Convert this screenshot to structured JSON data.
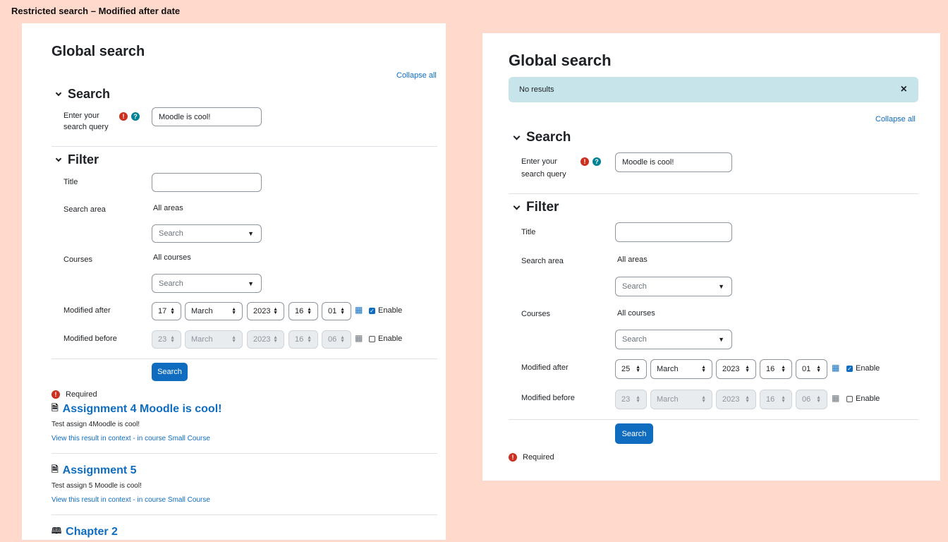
{
  "caption": "Restricted search – Modified after date",
  "left": {
    "title": "Global search",
    "collapse_all": "Collapse all",
    "search_section": "Search",
    "query_label": "Enter your search query",
    "query_value": "Moodle is cool!",
    "filter_section": "Filter",
    "title_label": "Title",
    "search_area_label": "Search area",
    "search_area_value": "All areas",
    "search_area_placeholder": "Search",
    "courses_label": "Courses",
    "courses_value": "All courses",
    "courses_placeholder": "Search",
    "modified_after_label": "Modified after",
    "after": {
      "day": "17",
      "month": "March",
      "year": "2023",
      "hour": "16",
      "minute": "01"
    },
    "modified_before_label": "Modified before",
    "before": {
      "day": "23",
      "month": "March",
      "year": "2023",
      "hour": "16",
      "minute": "06"
    },
    "enable_label": "Enable",
    "search_button": "Search",
    "required": "Required",
    "results": [
      {
        "title": "Assignment 4 Moodle is cool!",
        "text": "Test assign 4Moodle is cool!",
        "link": "View this result in context",
        "course": " - in course Small Course"
      },
      {
        "title": "Assignment 5",
        "text": "Test assign 5 Moodle is cool!",
        "link": "View this result in context",
        "course": " - in course Small Course"
      },
      {
        "title": "Chapter 2"
      }
    ]
  },
  "right": {
    "title": "Global search",
    "alert": "No results",
    "alert_close": "×",
    "collapse_all": "Collapse all",
    "search_section": "Search",
    "query_label": "Enter your search query",
    "query_value": "Moodle is cool!",
    "filter_section": "Filter",
    "title_label": "Title",
    "search_area_label": "Search area",
    "search_area_value": "All areas",
    "search_area_placeholder": "Search",
    "courses_label": "Courses",
    "courses_value": "All courses",
    "courses_placeholder": "Search",
    "modified_after_label": "Modified after",
    "after": {
      "day": "25",
      "month": "March",
      "year": "2023",
      "hour": "16",
      "minute": "01"
    },
    "modified_before_label": "Modified before",
    "before": {
      "day": "23",
      "month": "March",
      "year": "2023",
      "hour": "16",
      "minute": "06"
    },
    "enable_label": "Enable",
    "search_button": "Search",
    "required": "Required"
  },
  "icons": {
    "required": "exclamation-circle-icon",
    "help": "question-circle-icon",
    "calendar": "calendar-icon",
    "caret": "caret-down-icon",
    "assignment": "assignment-icon",
    "book": "book-icon"
  }
}
